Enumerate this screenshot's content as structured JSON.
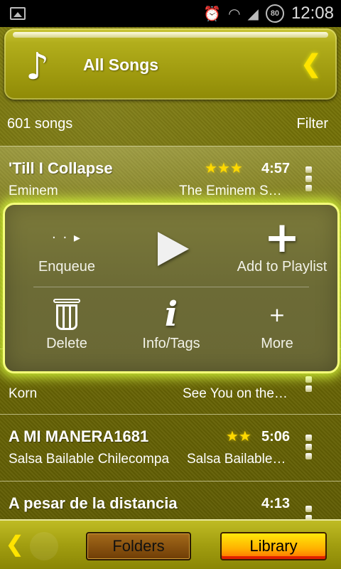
{
  "status": {
    "time": "12:08",
    "battery": "80"
  },
  "header": {
    "title": "All Songs"
  },
  "summary": {
    "count": "601 songs",
    "filter": "Filter"
  },
  "songs": [
    {
      "title": "'Till I Collapse",
      "artist": "Eminem",
      "album": "The Eminem S…",
      "duration": "4:57",
      "stars": "★★★"
    },
    {
      "title": "",
      "artist": "Korn",
      "album": "See You on the…",
      "duration": "",
      "stars": ""
    },
    {
      "title": "A MI MANERA1681",
      "artist": "Salsa Bailable Chilecompa",
      "album": "Salsa Bailable…",
      "duration": "5:06",
      "stars": "★★"
    },
    {
      "title": "A pesar de la distancia",
      "artist": "",
      "album": "",
      "duration": "4:13",
      "stars": ""
    }
  ],
  "popup": {
    "enqueue": "Enqueue",
    "add_to_playlist": "Add to Playlist",
    "delete": "Delete",
    "info_tags": "Info/Tags",
    "more": "More"
  },
  "bottom": {
    "folders": "Folders",
    "library": "Library"
  },
  "icons": {
    "header": "music-note-icon",
    "back": "chevron-left-icon",
    "play": "play-icon"
  },
  "colors": {
    "accent": "#ffe400",
    "popup_glow": "#f5ff7a"
  }
}
